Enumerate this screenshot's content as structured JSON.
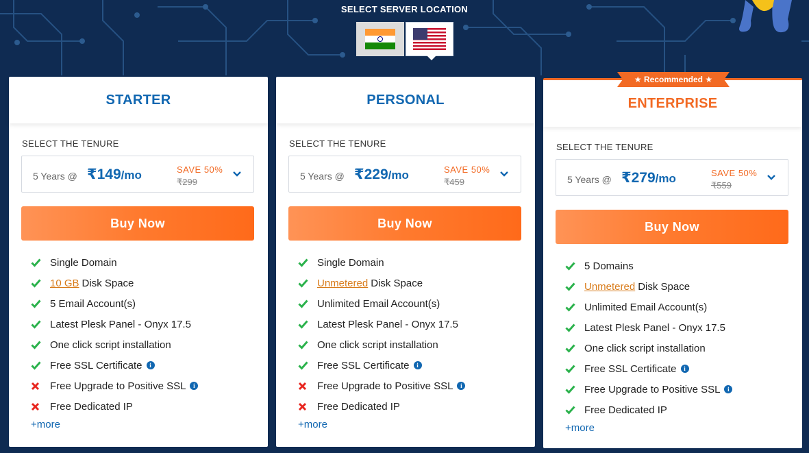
{
  "header": {
    "title": "SELECT SERVER LOCATION"
  },
  "locations": [
    {
      "name": "india-flag-icon",
      "selected": false
    },
    {
      "name": "usa-flag-icon",
      "selected": true
    }
  ],
  "colors": {
    "background": "#0f2b52",
    "accent": "#f26a24",
    "brand_blue": "#1167b1",
    "check": "#2bb24c",
    "cross": "#e8261f"
  },
  "plans": [
    {
      "name": "STARTER",
      "tenure_label": "SELECT THE TENURE",
      "tenure": "5 Years @",
      "price": "₹149",
      "per": "/mo",
      "save": "SAVE 50%",
      "old_price": "₹299",
      "buy_label": "Buy Now",
      "features": [
        {
          "icon": "check",
          "link": "",
          "text": "Single Domain",
          "info": false
        },
        {
          "icon": "check",
          "link": "10 GB",
          "text": "Disk Space",
          "info": false
        },
        {
          "icon": "check",
          "link": "",
          "text": "5 Email Account(s)",
          "info": false
        },
        {
          "icon": "check",
          "link": "",
          "text": "Latest Plesk Panel - Onyx 17.5",
          "info": false
        },
        {
          "icon": "check",
          "link": "",
          "text": "One click script installation",
          "info": false
        },
        {
          "icon": "check",
          "link": "",
          "text": "Free SSL Certificate",
          "info": true
        },
        {
          "icon": "cross",
          "link": "",
          "text": "Free Upgrade to Positive SSL",
          "info": true
        },
        {
          "icon": "cross",
          "link": "",
          "text": "Free Dedicated IP",
          "info": false
        }
      ],
      "more_label": "+more"
    },
    {
      "name": "PERSONAL",
      "tenure_label": "SELECT THE TENURE",
      "tenure": "5 Years @",
      "price": "₹229",
      "per": "/mo",
      "save": "SAVE 50%",
      "old_price": "₹459",
      "buy_label": "Buy Now",
      "features": [
        {
          "icon": "check",
          "link": "",
          "text": "Single Domain",
          "info": false
        },
        {
          "icon": "check",
          "link": "Unmetered",
          "text": "Disk Space",
          "info": false
        },
        {
          "icon": "check",
          "link": "",
          "text": "Unlimited Email Account(s)",
          "info": false
        },
        {
          "icon": "check",
          "link": "",
          "text": "Latest Plesk Panel - Onyx 17.5",
          "info": false
        },
        {
          "icon": "check",
          "link": "",
          "text": "One click script installation",
          "info": false
        },
        {
          "icon": "check",
          "link": "",
          "text": "Free SSL Certificate",
          "info": true
        },
        {
          "icon": "cross",
          "link": "",
          "text": "Free Upgrade to Positive SSL",
          "info": true
        },
        {
          "icon": "cross",
          "link": "",
          "text": "Free Dedicated IP",
          "info": false
        }
      ],
      "more_label": "+more"
    },
    {
      "name": "ENTERPRISE",
      "badge": "★ Recommended ★",
      "tenure_label": "SELECT THE TENURE",
      "tenure": "5 Years @",
      "price": "₹279",
      "per": "/mo",
      "save": "SAVE 50%",
      "old_price": "₹559",
      "buy_label": "Buy Now",
      "features": [
        {
          "icon": "check",
          "link": "",
          "text": "5 Domains",
          "info": false
        },
        {
          "icon": "check",
          "link": "Unmetered",
          "text": "Disk Space",
          "info": false
        },
        {
          "icon": "check",
          "link": "",
          "text": "Unlimited Email Account(s)",
          "info": false
        },
        {
          "icon": "check",
          "link": "",
          "text": "Latest Plesk Panel - Onyx 17.5",
          "info": false
        },
        {
          "icon": "check",
          "link": "",
          "text": "One click script installation",
          "info": false
        },
        {
          "icon": "check",
          "link": "",
          "text": "Free SSL Certificate",
          "info": true
        },
        {
          "icon": "check",
          "link": "",
          "text": "Free Upgrade to Positive SSL",
          "info": true
        },
        {
          "icon": "check",
          "link": "",
          "text": "Free Dedicated IP",
          "info": false
        }
      ],
      "more_label": "+more"
    }
  ]
}
